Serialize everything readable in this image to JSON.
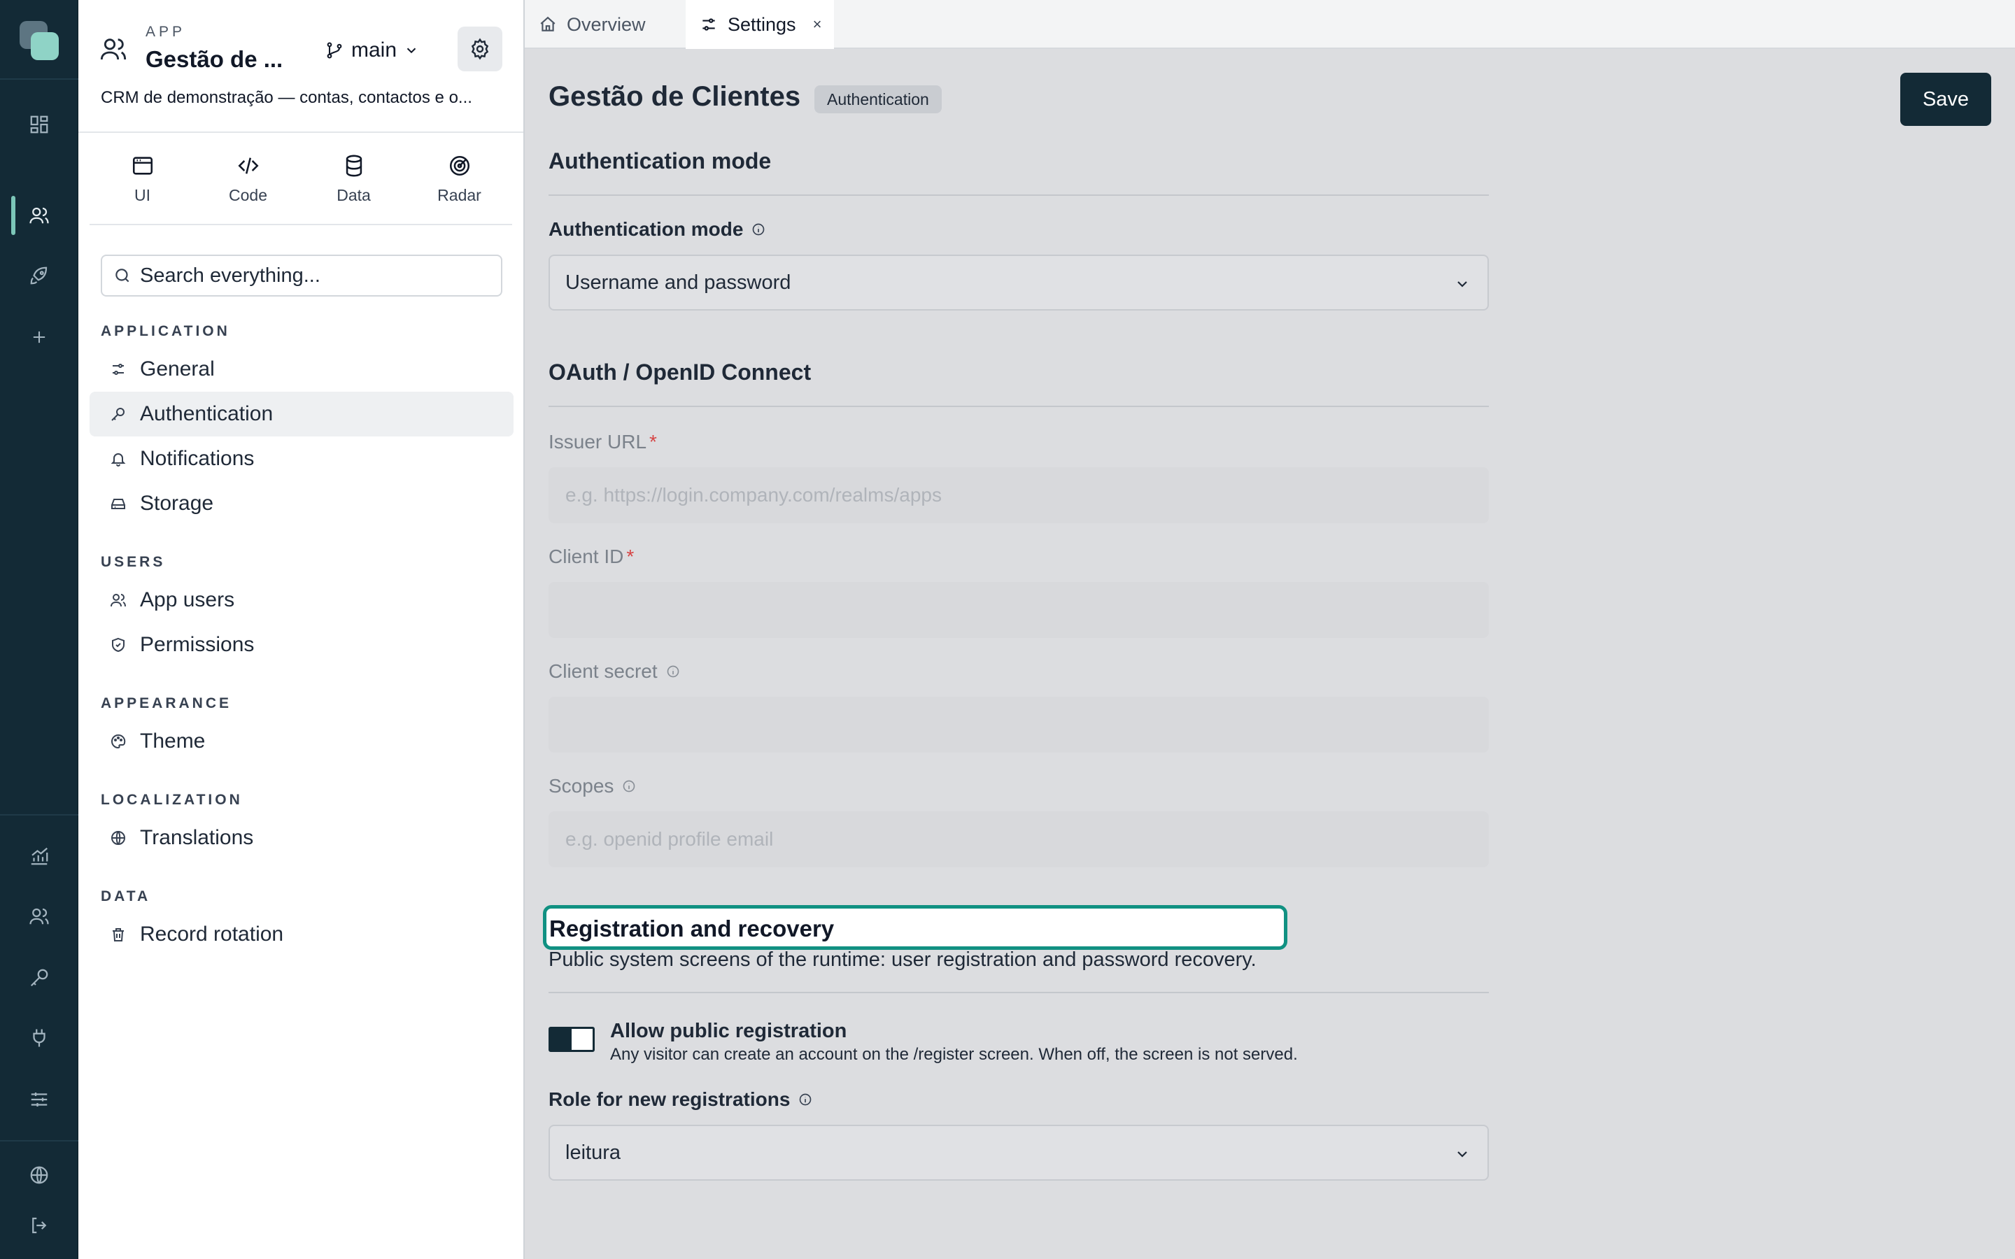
{
  "app": {
    "kicker": "APP",
    "name": "Gestão de ...",
    "branch": "main",
    "description": "CRM de demonstração — contas, contactos e o..."
  },
  "tools": [
    {
      "label": "UI",
      "icon": "window-icon"
    },
    {
      "label": "Code",
      "icon": "code-icon"
    },
    {
      "label": "Data",
      "icon": "database-icon"
    },
    {
      "label": "Radar",
      "icon": "radar-icon"
    }
  ],
  "search": {
    "placeholder": "Search everything..."
  },
  "nav": {
    "application_title": "APPLICATION",
    "general": "General",
    "authentication": "Authentication",
    "notifications": "Notifications",
    "storage": "Storage",
    "users_title": "USERS",
    "app_users": "App users",
    "permissions": "Permissions",
    "appearance_title": "APPEARANCE",
    "theme": "Theme",
    "localization_title": "LOCALIZATION",
    "translations": "Translations",
    "data_title": "DATA",
    "record_rotation": "Record rotation",
    "active": "Authentication"
  },
  "tabs": {
    "overview": "Overview",
    "settings": "Settings",
    "close_glyph": "×"
  },
  "page": {
    "title": "Gestão de Clientes",
    "badge": "Authentication",
    "save_label": "Save"
  },
  "auth_mode": {
    "section": "Authentication mode",
    "label": "Authentication mode",
    "value": "Username and password"
  },
  "oauth": {
    "section": "OAuth / OpenID Connect",
    "issuer_label": "Issuer URL",
    "issuer_placeholder": "e.g. https://login.company.com/realms/apps",
    "client_id_label": "Client ID",
    "client_secret_label": "Client secret",
    "scopes_label": "Scopes",
    "scopes_placeholder": "e.g. openid profile email",
    "required_mark": "*"
  },
  "registration": {
    "section": "Registration and recovery",
    "description": "Public system screens of the runtime: user registration and password recovery.",
    "toggle_title": "Allow public registration",
    "toggle_desc": "Any visitor can create an account on the /register screen. When off, the screen is not served.",
    "toggle_on": true,
    "role_label": "Role for new registrations",
    "role_value": "leitura"
  },
  "colors": {
    "rail": "#132a36",
    "accent": "#7cc6b8",
    "focus": "#119182",
    "required": "#d64545"
  }
}
